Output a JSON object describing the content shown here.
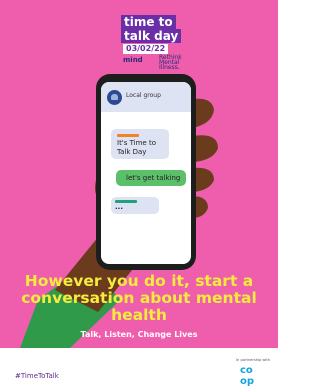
{
  "logo": {
    "line1": "time to",
    "line2": "talk day",
    "date": "03/02/22",
    "mind": "mind",
    "rethink": "Rethink Mental Illness."
  },
  "phone": {
    "group_name": "Local group",
    "messages": [
      {
        "text": "It's Time to Talk Day"
      },
      {
        "text": "let's get talking"
      },
      {
        "text": "..."
      }
    ]
  },
  "headline": "However you do it, start a conversation about mental health",
  "tagline": "Talk, Listen, Change Lives",
  "footer": {
    "hashtag": "#TimeToTalk",
    "partner_label": "In partnership with",
    "coop_logo": "coop"
  },
  "colors": {
    "background_pink": "#ef5eac",
    "headline_yellow": "#f5ec3c",
    "logo_purple": "#6a2fa7",
    "coop_blue": "#15a4dc"
  }
}
